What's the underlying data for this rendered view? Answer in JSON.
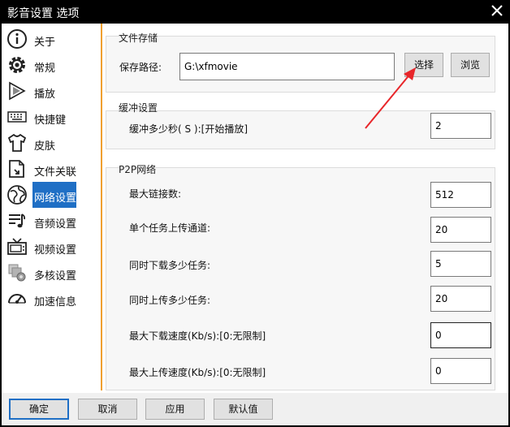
{
  "window": {
    "title": "影音设置 选项"
  },
  "sidebar": {
    "items": [
      {
        "label": "关于",
        "icon": "info-icon"
      },
      {
        "label": "常规",
        "icon": "gear-icon"
      },
      {
        "label": "播放",
        "icon": "play-icon"
      },
      {
        "label": "快捷键",
        "icon": "keyboard-icon"
      },
      {
        "label": "皮肤",
        "icon": "shirt-icon"
      },
      {
        "label": "文件关联",
        "icon": "file-link-icon"
      },
      {
        "label": "网络设置",
        "icon": "network-icon",
        "selected": true
      },
      {
        "label": "音频设置",
        "icon": "audio-list-icon"
      },
      {
        "label": "视频设置",
        "icon": "tv-icon"
      },
      {
        "label": "多核设置",
        "icon": "multicore-icon"
      },
      {
        "label": "加速信息",
        "icon": "speedometer-icon"
      }
    ]
  },
  "storage": {
    "group_title": "文件存储",
    "path_label": "保存路径:",
    "path_value": "G:\\xfmovie",
    "select_button": "选择",
    "browse_button": "浏览"
  },
  "buffer": {
    "group_title": "缓冲设置",
    "seconds_label": "缓冲多少秒( S ):[开始播放]",
    "seconds_value": "2"
  },
  "p2p": {
    "group_title": "P2P网络",
    "max_connections_label": "最大链接数:",
    "max_connections_value": "512",
    "upload_channels_label": "单个任务上传通道:",
    "upload_channels_value": "20",
    "concurrent_downloads_label": "同时下载多少任务:",
    "concurrent_downloads_value": "5",
    "concurrent_uploads_label": "同时上传多少任务:",
    "concurrent_uploads_value": "20",
    "max_download_speed_label": "最大下载速度(Kb/s):[0:无限制]",
    "max_download_speed_value": "0",
    "max_upload_speed_label": "最大上传速度(Kb/s):[0:无限制]",
    "max_upload_speed_value": "0"
  },
  "footer": {
    "ok": "确定",
    "cancel": "取消",
    "apply": "应用",
    "default": "默认值"
  },
  "colors": {
    "accent": "#1f6fc5",
    "divider": "#f0a030",
    "annotation_arrow": "#e8262a"
  }
}
